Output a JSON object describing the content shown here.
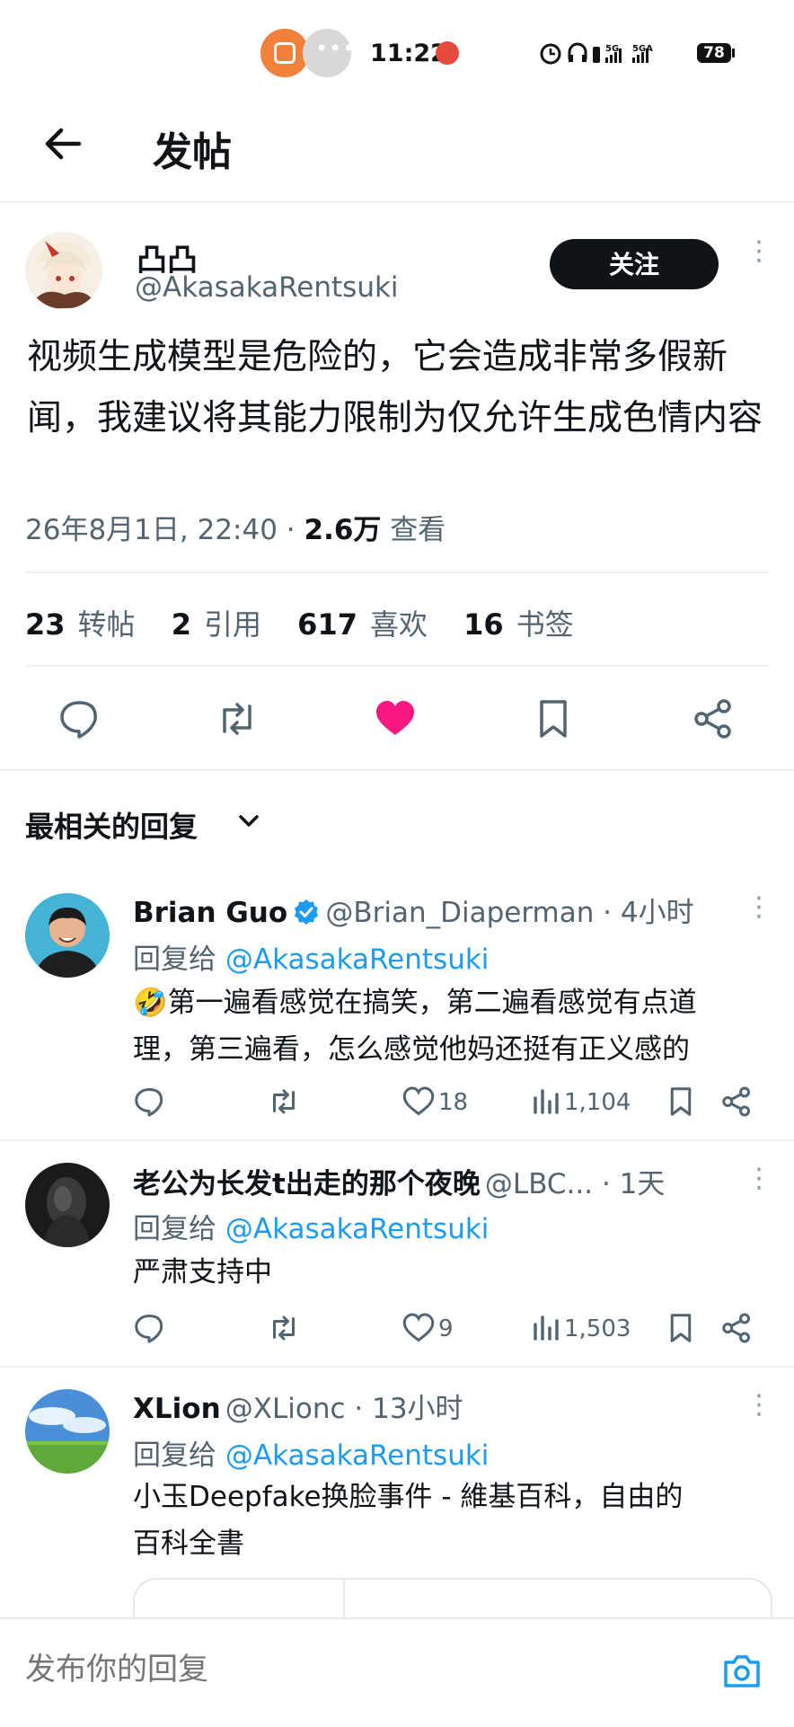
{
  "status_bar": {
    "time": "11:22",
    "network_1": "5G",
    "network_2": "5GA",
    "battery": "78"
  },
  "header": {
    "back_icon": "arrow-left-icon",
    "title": "发帖"
  },
  "post": {
    "author_name": "凸凸",
    "author_handle": "@AkasakaRentsuki",
    "follow_label": "关注",
    "text": "视频生成模型是危险的，它会造成非常多假新闻，我建议将其能力限制为仅允许生成色情内容",
    "timestamp": "26年8月1日, 22:40 · ",
    "views_count": "2.6万",
    "views_label": " 查看",
    "stats": {
      "reposts_count": "23",
      "reposts_label": "转帖",
      "quotes_count": "2",
      "quotes_label": "引用",
      "likes_count": "617",
      "likes_label": "喜欢",
      "bookmarks_count": "16",
      "bookmarks_label": "书签"
    },
    "like_color": "#f91880"
  },
  "sort": {
    "label": "最相关的回复"
  },
  "replies": [
    {
      "name": "Brian Guo",
      "handle": "@Brian_Diaperman · 4小时",
      "reply_to_prefix": "回复给 ",
      "reply_to": "@AkasakaRentsuki",
      "text_line1": "🤣第一遍看感觉在搞笑，第二遍看感觉有点道",
      "text_line2": "理，第三遍看，怎么感觉他妈还挺有正义感的",
      "likes": "18",
      "views": "1,104"
    },
    {
      "name": "老公为长发t出走的那个夜晚",
      "handle": "@LBC... · 1天",
      "reply_to_prefix": "回复给 ",
      "reply_to": "@AkasakaRentsuki",
      "text_line1": "严肃支持中",
      "likes": "9",
      "views": "1,503"
    },
    {
      "name": "XLion",
      "handle": "@XLionc · 13小时",
      "reply_to_prefix": "回复给 ",
      "reply_to": "@AkasakaRentsuki",
      "text_line1": "小玉Deepfake换脸事件 - 維基百科，自由的",
      "text_line2": "百科全書"
    }
  ],
  "composer": {
    "placeholder": "发布你的回复"
  },
  "colors": {
    "link": "#1d9bf0",
    "verified": "#1d9bf0",
    "text": "#0f1419",
    "muted": "#536471"
  }
}
